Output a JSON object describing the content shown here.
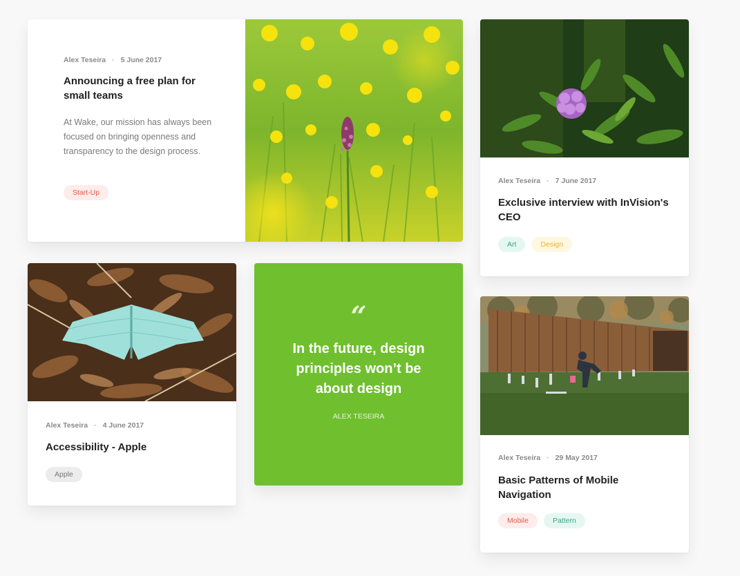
{
  "colors": {
    "background": "#f8f8f8",
    "quote_bg": "#6fbf2f",
    "tag_red": "#e05a4f",
    "tag_teal": "#35a585",
    "tag_yellow": "#e5b33a"
  },
  "posts": [
    {
      "author": "Alex Teseira",
      "date": "5 June 2017",
      "title": "Announcing a free plan for small teams",
      "excerpt": "At Wake, our mission has always been focused on bringing openness and transparency to the design process.",
      "tags": [
        "Start-Up"
      ],
      "image": "yellow-wildflower-meadow-photo"
    },
    {
      "author": "Alex Teseira",
      "date": "7 June 2017",
      "title": "Exclusive interview with InVision's CEO",
      "tags": [
        "Art",
        "Design"
      ],
      "image": "purple-rhododendron-photo"
    },
    {
      "author": "Alex Teseira",
      "date": "4 June 2017",
      "title": "Accessibility - Apple",
      "tags": [
        "Apple"
      ],
      "image": "pale-blue-moth-on-leaves-photo"
    },
    {
      "author": "Alex Teseira",
      "date": "29 May 2017",
      "title": "Basic Patterns of Mobile Navigation",
      "tags": [
        "Mobile",
        "Pattern"
      ],
      "image": "wooden-barn-field-photo"
    }
  ],
  "quote": {
    "mark": "“",
    "text": "In the future, design principles won’t be about design",
    "author": "ALEX TESEIRA"
  }
}
